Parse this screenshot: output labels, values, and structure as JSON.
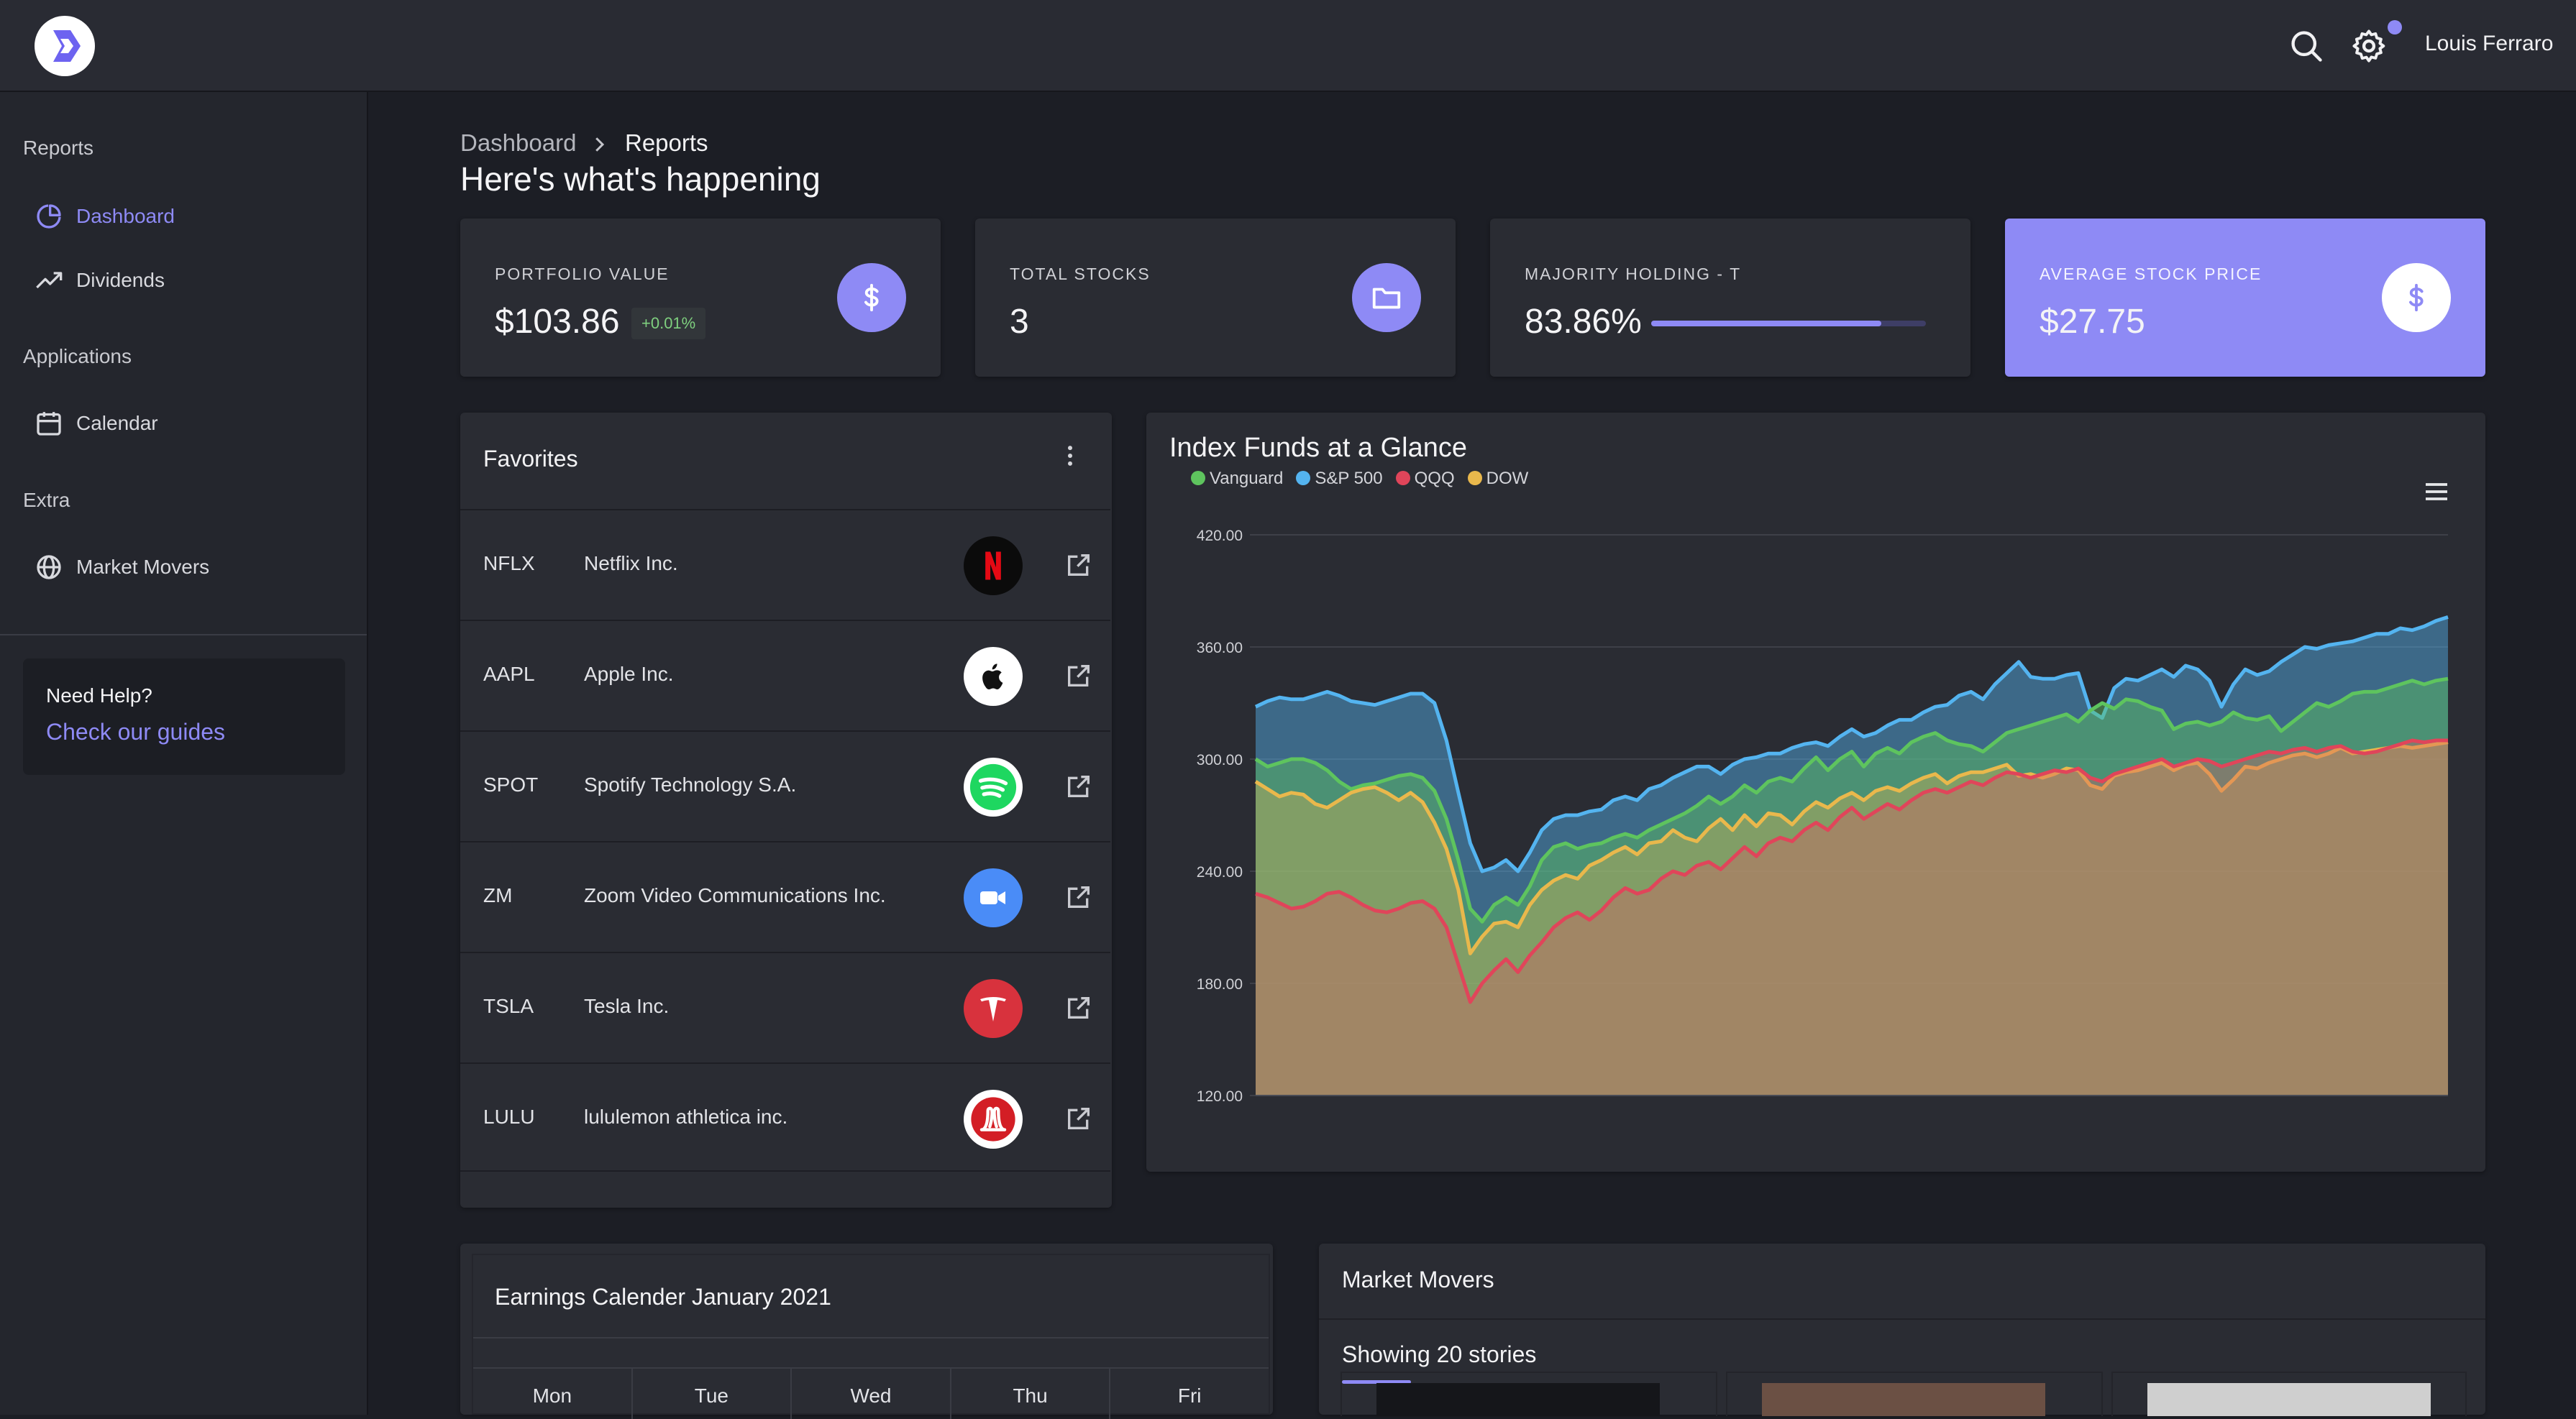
{
  "user": {
    "name": "Louis Ferraro"
  },
  "sidebar": {
    "sections": [
      "Reports",
      "Applications",
      "Extra"
    ],
    "items": [
      {
        "label": "Dashboard",
        "icon": "pie-chart-icon",
        "active": true
      },
      {
        "label": "Dividends",
        "icon": "trending-up-icon",
        "active": false
      },
      {
        "label": "Calendar",
        "icon": "calendar-icon",
        "active": false
      },
      {
        "label": "Market Movers",
        "icon": "globe-icon",
        "active": false
      }
    ],
    "help": {
      "title": "Need Help?",
      "link": "Check our guides"
    }
  },
  "breadcrumb": {
    "root": "Dashboard",
    "current": "Reports"
  },
  "page_title": "Here's what's happening",
  "stats": [
    {
      "label": "PORTFOLIO VALUE",
      "value": "$103.86",
      "change": "+0.01%",
      "icon": "dollar-icon"
    },
    {
      "label": "TOTAL STOCKS",
      "value": "3",
      "icon": "folder-icon"
    },
    {
      "label": "MAJORITY HOLDING - T",
      "value": "83.86%",
      "progress": 0.8386
    },
    {
      "label": "AVERAGE STOCK PRICE",
      "value": "$27.75",
      "icon": "dollar-icon"
    }
  ],
  "favorites": {
    "title": "Favorites",
    "rows": [
      {
        "symbol": "NFLX",
        "name": "Netflix Inc.",
        "logo": "netflix-logo-icon"
      },
      {
        "symbol": "AAPL",
        "name": "Apple Inc.",
        "logo": "apple-logo-icon"
      },
      {
        "symbol": "SPOT",
        "name": "Spotify Technology S.A.",
        "logo": "spotify-logo-icon"
      },
      {
        "symbol": "ZM",
        "name": "Zoom Video Communications Inc.",
        "logo": "zoom-logo-icon"
      },
      {
        "symbol": "TSLA",
        "name": "Tesla Inc.",
        "logo": "tesla-logo-icon"
      },
      {
        "symbol": "LULU",
        "name": "lululemon athletica inc.",
        "logo": "lululemon-logo-icon"
      }
    ]
  },
  "chart_data": {
    "type": "area",
    "title": "Index Funds at a Glance",
    "ylim": [
      120,
      420
    ],
    "yticks": [
      "420.00",
      "360.00",
      "300.00",
      "240.00",
      "180.00",
      "120.00"
    ],
    "legend_position": "top-left",
    "grid": true,
    "series": [
      {
        "name": "Vanguard",
        "color": "#5ec45e",
        "values": [
          300,
          296,
          298,
          300,
          300,
          298,
          294,
          288,
          284,
          286,
          287,
          289,
          291,
          292,
          290,
          283,
          268,
          246,
          220,
          213,
          222,
          226,
          222,
          232,
          246,
          253,
          255,
          252,
          254,
          255,
          258,
          260,
          258,
          262,
          265,
          268,
          271,
          275,
          280,
          276,
          280,
          286,
          282,
          288,
          290,
          288,
          295,
          301,
          294,
          300,
          304,
          296,
          303,
          306,
          303,
          309,
          312,
          314,
          310,
          308,
          307,
          304,
          309,
          314,
          316,
          318,
          320,
          322,
          324,
          320,
          326,
          330,
          327,
          332,
          331,
          328,
          326,
          316,
          319,
          320,
          318,
          320,
          325,
          322,
          321,
          323,
          315,
          320,
          325,
          330,
          328,
          331,
          335,
          336,
          336,
          338,
          340,
          342,
          340,
          342,
          343
        ]
      },
      {
        "name": "S&P 500",
        "color": "#54b4f0",
        "values": [
          328,
          331,
          333,
          332,
          332,
          334,
          336,
          334,
          331,
          330,
          329,
          331,
          333,
          335,
          335,
          330,
          310,
          282,
          255,
          240,
          242,
          246,
          240,
          250,
          262,
          268,
          270,
          270,
          272,
          273,
          278,
          280,
          278,
          284,
          286,
          290,
          293,
          296,
          296,
          292,
          297,
          300,
          301,
          303,
          303,
          306,
          308,
          309,
          307,
          312,
          316,
          312,
          314,
          318,
          321,
          321,
          325,
          328,
          329,
          334,
          336,
          332,
          340,
          346,
          352,
          344,
          343,
          343,
          345,
          346,
          326,
          322,
          338,
          343,
          342,
          345,
          348,
          344,
          350,
          348,
          342,
          328,
          340,
          348,
          345,
          347,
          352,
          356,
          360,
          359,
          361,
          362,
          363,
          365,
          367,
          367,
          370,
          369,
          371,
          374,
          376
        ]
      },
      {
        "name": "QQQ",
        "color": "#e0455a",
        "values": [
          228,
          226,
          223,
          220,
          221,
          224,
          228,
          229,
          226,
          222,
          219,
          218,
          220,
          223,
          224,
          220,
          210,
          190,
          170,
          180,
          187,
          193,
          186,
          195,
          202,
          210,
          215,
          218,
          214,
          219,
          226,
          231,
          228,
          230,
          236,
          240,
          238,
          243,
          245,
          241,
          247,
          253,
          248,
          255,
          258,
          256,
          262,
          266,
          262,
          269,
          274,
          268,
          272,
          276,
          273,
          278,
          282,
          284,
          282,
          285,
          288,
          286,
          290,
          293,
          292,
          290,
          292,
          294,
          293,
          295,
          290,
          288,
          292,
          294,
          296,
          298,
          300,
          296,
          298,
          300,
          299,
          296,
          298,
          300,
          302,
          304,
          303,
          305,
          306,
          304,
          306,
          307,
          304,
          303,
          304,
          306,
          308,
          310,
          309,
          310,
          310
        ]
      },
      {
        "name": "DOW",
        "color": "#e9b84c",
        "values": [
          288,
          284,
          280,
          282,
          281,
          276,
          274,
          278,
          282,
          284,
          285,
          282,
          278,
          282,
          277,
          266,
          252,
          230,
          196,
          205,
          212,
          213,
          210,
          222,
          230,
          235,
          238,
          236,
          243,
          246,
          250,
          253,
          249,
          255,
          256,
          262,
          258,
          256,
          263,
          268,
          262,
          270,
          264,
          271,
          270,
          265,
          272,
          277,
          274,
          279,
          282,
          278,
          283,
          285,
          283,
          287,
          290,
          292,
          287,
          291,
          293,
          293,
          295,
          297,
          291,
          292,
          290,
          292,
          295,
          294,
          286,
          284,
          291,
          293,
          294,
          296,
          298,
          294,
          297,
          298,
          292,
          283,
          289,
          296,
          295,
          298,
          300,
          302,
          303,
          301,
          303,
          306,
          303,
          304,
          305,
          306,
          307,
          306,
          307,
          308,
          309
        ]
      }
    ]
  },
  "calendar": {
    "title": "Earnings Calender January 2021",
    "days": [
      "Mon",
      "Tue",
      "Wed",
      "Thu",
      "Fri"
    ]
  },
  "market_movers": {
    "title": "Market Movers",
    "tab": "Showing 20 stories"
  }
}
